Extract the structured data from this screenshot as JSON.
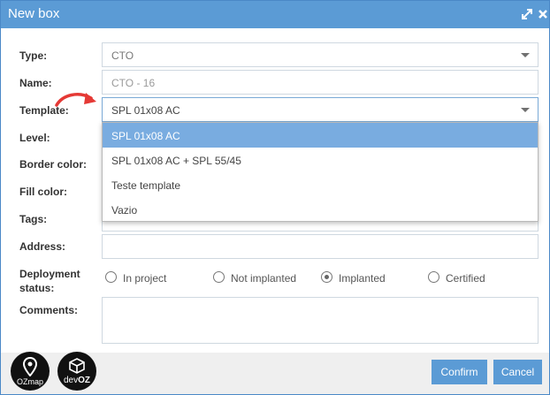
{
  "window": {
    "title": "New box",
    "maximize_icon": "maximize-icon",
    "close_icon": "close-icon"
  },
  "form": {
    "type": {
      "label": "Type:",
      "value": "CTO"
    },
    "name": {
      "label": "Name:",
      "placeholder": "CTO - 16"
    },
    "template": {
      "label": "Template:",
      "value": "SPL 01x08 AC"
    },
    "level": {
      "label": "Level:"
    },
    "border_color": {
      "label": "Border color:"
    },
    "fill_color": {
      "label": "Fill color:"
    },
    "tags": {
      "label": "Tags:"
    },
    "address": {
      "label": "Address:"
    },
    "deployment": {
      "label_line1": "Deployment",
      "label_line2": "status:",
      "options": [
        "In project",
        "Not implanted",
        "Implanted",
        "Certified"
      ],
      "selected": "Implanted"
    },
    "comments": {
      "label": "Comments:"
    }
  },
  "dropdown": {
    "options": [
      "SPL 01x08 AC",
      "SPL 01x08 AC + SPL 55/45",
      "Teste template",
      "Vazio"
    ],
    "highlighted": "SPL 01x08 AC"
  },
  "footer": {
    "confirm_label": "Confirm",
    "cancel_label": "Cancel"
  },
  "logos": {
    "ozmap": "OZmap",
    "devoz_prefix": "dev",
    "devoz_suffix": "OZ"
  },
  "colors": {
    "accent": "#5b9bd5",
    "highlight": "#79ace0",
    "arrow": "#e53935"
  }
}
